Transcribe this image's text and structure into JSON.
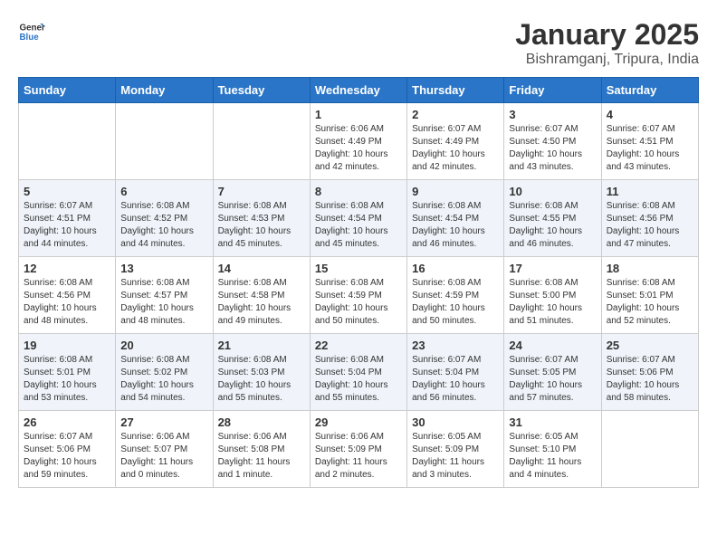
{
  "header": {
    "logo_line1": "General",
    "logo_line2": "Blue",
    "month": "January 2025",
    "location": "Bishramganj, Tripura, India"
  },
  "weekdays": [
    "Sunday",
    "Monday",
    "Tuesday",
    "Wednesday",
    "Thursday",
    "Friday",
    "Saturday"
  ],
  "weeks": [
    [
      {
        "day": "",
        "sunrise": "",
        "sunset": "",
        "daylight": ""
      },
      {
        "day": "",
        "sunrise": "",
        "sunset": "",
        "daylight": ""
      },
      {
        "day": "",
        "sunrise": "",
        "sunset": "",
        "daylight": ""
      },
      {
        "day": "1",
        "sunrise": "Sunrise: 6:06 AM",
        "sunset": "Sunset: 4:49 PM",
        "daylight": "Daylight: 10 hours and 42 minutes."
      },
      {
        "day": "2",
        "sunrise": "Sunrise: 6:07 AM",
        "sunset": "Sunset: 4:49 PM",
        "daylight": "Daylight: 10 hours and 42 minutes."
      },
      {
        "day": "3",
        "sunrise": "Sunrise: 6:07 AM",
        "sunset": "Sunset: 4:50 PM",
        "daylight": "Daylight: 10 hours and 43 minutes."
      },
      {
        "day": "4",
        "sunrise": "Sunrise: 6:07 AM",
        "sunset": "Sunset: 4:51 PM",
        "daylight": "Daylight: 10 hours and 43 minutes."
      }
    ],
    [
      {
        "day": "5",
        "sunrise": "Sunrise: 6:07 AM",
        "sunset": "Sunset: 4:51 PM",
        "daylight": "Daylight: 10 hours and 44 minutes."
      },
      {
        "day": "6",
        "sunrise": "Sunrise: 6:08 AM",
        "sunset": "Sunset: 4:52 PM",
        "daylight": "Daylight: 10 hours and 44 minutes."
      },
      {
        "day": "7",
        "sunrise": "Sunrise: 6:08 AM",
        "sunset": "Sunset: 4:53 PM",
        "daylight": "Daylight: 10 hours and 45 minutes."
      },
      {
        "day": "8",
        "sunrise": "Sunrise: 6:08 AM",
        "sunset": "Sunset: 4:54 PM",
        "daylight": "Daylight: 10 hours and 45 minutes."
      },
      {
        "day": "9",
        "sunrise": "Sunrise: 6:08 AM",
        "sunset": "Sunset: 4:54 PM",
        "daylight": "Daylight: 10 hours and 46 minutes."
      },
      {
        "day": "10",
        "sunrise": "Sunrise: 6:08 AM",
        "sunset": "Sunset: 4:55 PM",
        "daylight": "Daylight: 10 hours and 46 minutes."
      },
      {
        "day": "11",
        "sunrise": "Sunrise: 6:08 AM",
        "sunset": "Sunset: 4:56 PM",
        "daylight": "Daylight: 10 hours and 47 minutes."
      }
    ],
    [
      {
        "day": "12",
        "sunrise": "Sunrise: 6:08 AM",
        "sunset": "Sunset: 4:56 PM",
        "daylight": "Daylight: 10 hours and 48 minutes."
      },
      {
        "day": "13",
        "sunrise": "Sunrise: 6:08 AM",
        "sunset": "Sunset: 4:57 PM",
        "daylight": "Daylight: 10 hours and 48 minutes."
      },
      {
        "day": "14",
        "sunrise": "Sunrise: 6:08 AM",
        "sunset": "Sunset: 4:58 PM",
        "daylight": "Daylight: 10 hours and 49 minutes."
      },
      {
        "day": "15",
        "sunrise": "Sunrise: 6:08 AM",
        "sunset": "Sunset: 4:59 PM",
        "daylight": "Daylight: 10 hours and 50 minutes."
      },
      {
        "day": "16",
        "sunrise": "Sunrise: 6:08 AM",
        "sunset": "Sunset: 4:59 PM",
        "daylight": "Daylight: 10 hours and 50 minutes."
      },
      {
        "day": "17",
        "sunrise": "Sunrise: 6:08 AM",
        "sunset": "Sunset: 5:00 PM",
        "daylight": "Daylight: 10 hours and 51 minutes."
      },
      {
        "day": "18",
        "sunrise": "Sunrise: 6:08 AM",
        "sunset": "Sunset: 5:01 PM",
        "daylight": "Daylight: 10 hours and 52 minutes."
      }
    ],
    [
      {
        "day": "19",
        "sunrise": "Sunrise: 6:08 AM",
        "sunset": "Sunset: 5:01 PM",
        "daylight": "Daylight: 10 hours and 53 minutes."
      },
      {
        "day": "20",
        "sunrise": "Sunrise: 6:08 AM",
        "sunset": "Sunset: 5:02 PM",
        "daylight": "Daylight: 10 hours and 54 minutes."
      },
      {
        "day": "21",
        "sunrise": "Sunrise: 6:08 AM",
        "sunset": "Sunset: 5:03 PM",
        "daylight": "Daylight: 10 hours and 55 minutes."
      },
      {
        "day": "22",
        "sunrise": "Sunrise: 6:08 AM",
        "sunset": "Sunset: 5:04 PM",
        "daylight": "Daylight: 10 hours and 55 minutes."
      },
      {
        "day": "23",
        "sunrise": "Sunrise: 6:07 AM",
        "sunset": "Sunset: 5:04 PM",
        "daylight": "Daylight: 10 hours and 56 minutes."
      },
      {
        "day": "24",
        "sunrise": "Sunrise: 6:07 AM",
        "sunset": "Sunset: 5:05 PM",
        "daylight": "Daylight: 10 hours and 57 minutes."
      },
      {
        "day": "25",
        "sunrise": "Sunrise: 6:07 AM",
        "sunset": "Sunset: 5:06 PM",
        "daylight": "Daylight: 10 hours and 58 minutes."
      }
    ],
    [
      {
        "day": "26",
        "sunrise": "Sunrise: 6:07 AM",
        "sunset": "Sunset: 5:06 PM",
        "daylight": "Daylight: 10 hours and 59 minutes."
      },
      {
        "day": "27",
        "sunrise": "Sunrise: 6:06 AM",
        "sunset": "Sunset: 5:07 PM",
        "daylight": "Daylight: 11 hours and 0 minutes."
      },
      {
        "day": "28",
        "sunrise": "Sunrise: 6:06 AM",
        "sunset": "Sunset: 5:08 PM",
        "daylight": "Daylight: 11 hours and 1 minute."
      },
      {
        "day": "29",
        "sunrise": "Sunrise: 6:06 AM",
        "sunset": "Sunset: 5:09 PM",
        "daylight": "Daylight: 11 hours and 2 minutes."
      },
      {
        "day": "30",
        "sunrise": "Sunrise: 6:05 AM",
        "sunset": "Sunset: 5:09 PM",
        "daylight": "Daylight: 11 hours and 3 minutes."
      },
      {
        "day": "31",
        "sunrise": "Sunrise: 6:05 AM",
        "sunset": "Sunset: 5:10 PM",
        "daylight": "Daylight: 11 hours and 4 minutes."
      },
      {
        "day": "",
        "sunrise": "",
        "sunset": "",
        "daylight": ""
      }
    ]
  ]
}
